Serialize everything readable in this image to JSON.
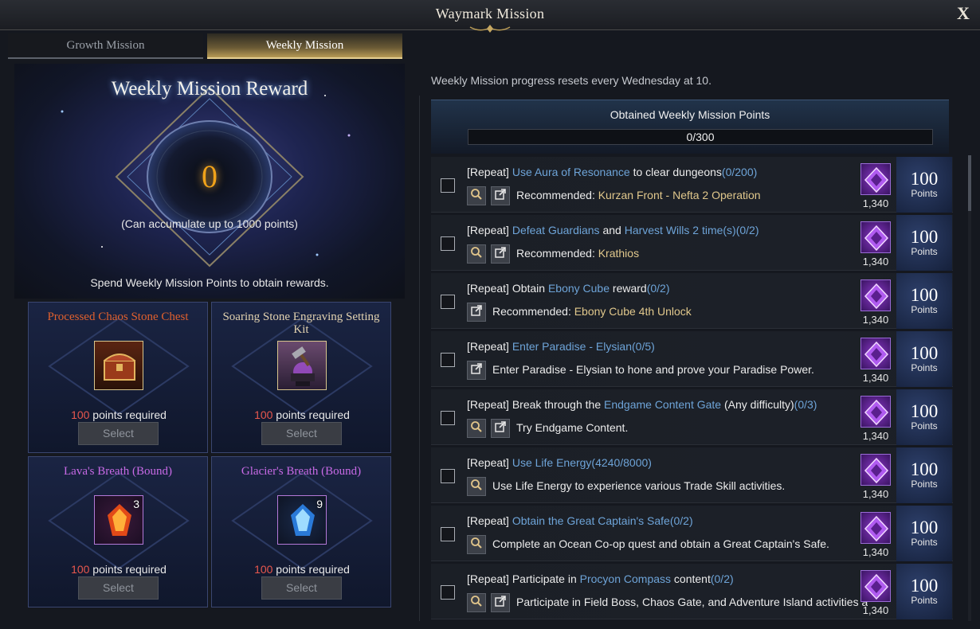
{
  "window": {
    "title": "Waymark Mission",
    "close_label": "X"
  },
  "tabs": [
    {
      "label": "Growth Mission",
      "active": false
    },
    {
      "label": "Weekly Mission",
      "active": true
    }
  ],
  "reward_panel": {
    "title": "Weekly Mission Reward",
    "points": "0",
    "accumulate_note": "(Can accumulate up to 1000 points)",
    "spend_note": "Spend Weekly Mission Points to obtain rewards.",
    "rewards": [
      {
        "name": "Processed Chaos Stone Chest",
        "name_color": "#e0602e",
        "icon": "treasure-chest-icon",
        "quantity": "",
        "cost": "100",
        "cost_suffix": " points required",
        "button": "Select"
      },
      {
        "name": "Soaring Stone Engraving Setting Kit",
        "name_color": "#e2d2b0",
        "icon": "anvil-hammer-icon",
        "quantity": "",
        "cost": "100",
        "cost_suffix": " points required",
        "button": "Select"
      },
      {
        "name": "Lava's Breath (Bound)",
        "name_color": "#c86ae6",
        "icon": "lava-crystal-icon",
        "quantity": "3",
        "cost": "100",
        "cost_suffix": " points required",
        "button": "Select"
      },
      {
        "name": "Glacier's Breath (Bound)",
        "name_color": "#c86ae6",
        "icon": "glacier-crystal-icon",
        "quantity": "9",
        "cost": "100",
        "cost_suffix": " points required",
        "button": "Select"
      }
    ]
  },
  "missions_panel": {
    "reset_note": "Weekly Mission progress resets every Wednesday at 10.",
    "obtained_label": "Obtained Weekly Mission Points",
    "progress_text": "0/300",
    "progress_fraction": 0,
    "missions": [
      {
        "prefix": "[Repeat] ",
        "hl1": "Use Aura of Resonance",
        "mid": " to clear dungeons",
        "hl2": "(0/200)",
        "tail": "",
        "actions": [
          "search",
          "goto"
        ],
        "line2_prefix": "Recommended: ",
        "line2_rec": "Kurzan Front - Nefta 2 Operation",
        "reward_count": "1,340",
        "points": "100",
        "points_unit": "Points"
      },
      {
        "prefix": "[Repeat] ",
        "hl1": "Defeat Guardians",
        "mid": " and ",
        "hl2": "Harvest Wills 2 time(s)(0/2)",
        "tail": "",
        "actions": [
          "search",
          "goto"
        ],
        "line2_prefix": "Recommended: ",
        "line2_rec": "Krathios",
        "reward_count": "1,340",
        "points": "100",
        "points_unit": "Points"
      },
      {
        "prefix": "[Repeat] Obtain ",
        "hl1": "Ebony Cube",
        "mid": " reward",
        "hl2": "(0/2)",
        "tail": "",
        "actions": [
          "goto"
        ],
        "line2_prefix": "Recommended: ",
        "line2_rec": "Ebony Cube 4th Unlock",
        "reward_count": "1,340",
        "points": "100",
        "points_unit": "Points"
      },
      {
        "prefix": "[Repeat] ",
        "hl1": "Enter Paradise - Elysian(0/5)",
        "mid": "",
        "hl2": "",
        "tail": "",
        "actions": [
          "goto"
        ],
        "line2_prefix": "Enter Paradise - Elysian to hone and prove your Paradise Power.",
        "line2_rec": "",
        "reward_count": "1,340",
        "points": "100",
        "points_unit": "Points"
      },
      {
        "prefix": "[Repeat] Break through the ",
        "hl1": "Endgame Content Gate",
        "mid": " (Any difficulty)",
        "hl2": "(0/3)",
        "tail": "",
        "actions": [
          "search",
          "goto"
        ],
        "line2_prefix": "Try Endgame Content.",
        "line2_rec": "",
        "reward_count": "1,340",
        "points": "100",
        "points_unit": "Points"
      },
      {
        "prefix": "[Repeat] ",
        "hl1": "Use Life Energy(4240/8000)",
        "mid": "",
        "hl2": "",
        "tail": "",
        "actions": [
          "search"
        ],
        "line2_prefix": "Use Life Energy to experience various Trade Skill activities.",
        "line2_rec": "",
        "reward_count": "1,340",
        "points": "100",
        "points_unit": "Points"
      },
      {
        "prefix": "[Repeat] ",
        "hl1": "Obtain the Great Captain's Safe(0/2)",
        "mid": "",
        "hl2": "",
        "tail": "",
        "actions": [
          "search"
        ],
        "line2_prefix": "Complete an Ocean Co-op quest and obtain a Great Captain's Safe.",
        "line2_rec": "",
        "reward_count": "1,340",
        "points": "100",
        "points_unit": "Points"
      },
      {
        "prefix": "[Repeat] Participate in ",
        "hl1": "Procyon Compass",
        "mid": " content",
        "hl2": "(0/2)",
        "tail": "",
        "actions": [
          "search",
          "goto"
        ],
        "line2_prefix": "Participate in Field Boss, Chaos Gate, and Adventure Island activities a",
        "line2_rec": "",
        "reward_count": "1,340",
        "points": "100",
        "points_unit": "Points"
      }
    ]
  },
  "colors": {
    "accent_gold": "#e4cf92",
    "highlight_blue": "#6ea4d8",
    "recommended_gold": "#e1c88c",
    "cost_red": "#e8574d",
    "points_orange": "#f0a21a"
  }
}
